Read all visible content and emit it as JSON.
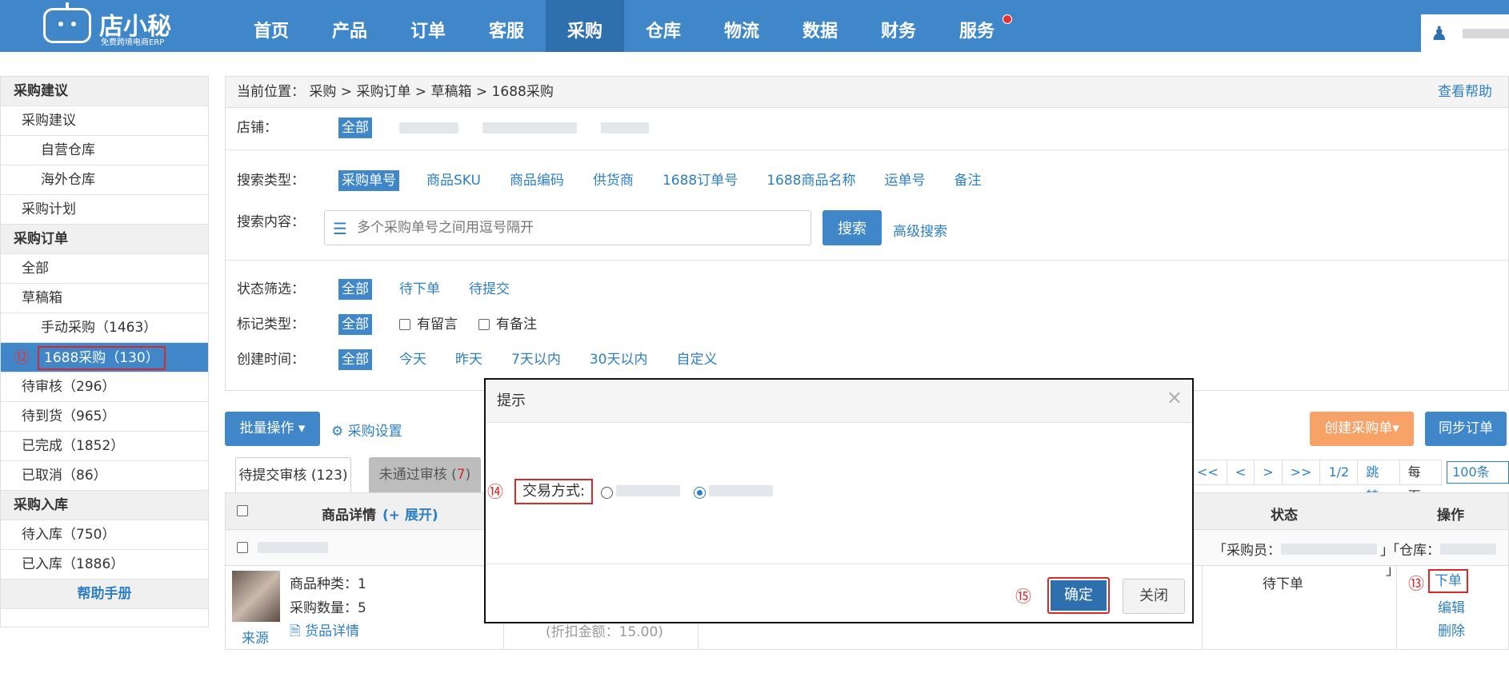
{
  "app": {
    "logo_name": "店小秘",
    "logo_sub": "免费跨境电商ERP",
    "nav": [
      "首页",
      "产品",
      "订单",
      "客服",
      "采购",
      "仓库",
      "物流",
      "数据",
      "财务",
      "服务"
    ],
    "nav_active": "采购"
  },
  "sidebar": {
    "sections": [
      {
        "title": "采购建议",
        "items": [
          {
            "label": "采购建议",
            "level": 1
          },
          {
            "label": "自营仓库",
            "level": 2
          },
          {
            "label": "海外仓库",
            "level": 2
          },
          {
            "label": "采购计划",
            "level": 1
          }
        ]
      },
      {
        "title": "采购订单",
        "items": [
          {
            "label": "全部",
            "level": 1
          },
          {
            "label": "草稿箱",
            "level": 1
          },
          {
            "label": "手动采购（1463）",
            "level": 2
          },
          {
            "label": "1688采购（130）",
            "level": 2,
            "active": true,
            "marker": "⑫"
          },
          {
            "label": "待审核（296）",
            "level": 1
          },
          {
            "label": "待到货（965）",
            "level": 1
          },
          {
            "label": "已完成（1852）",
            "level": 1
          },
          {
            "label": "已取消（86）",
            "level": 1
          }
        ]
      },
      {
        "title": "采购入库",
        "items": [
          {
            "label": "待入库（750）",
            "level": 1
          },
          {
            "label": "已入库（1886）",
            "level": 1
          }
        ]
      }
    ],
    "help": "帮助手册"
  },
  "breadcrumb": {
    "prefix": "当前位置：",
    "path": "采购 > 采购订单 > 草稿箱 > 1688采购",
    "help": "查看帮助"
  },
  "filters": {
    "shop_label": "店铺：",
    "shop_all": "全部",
    "search_type_label": "搜索类型：",
    "search_types": [
      "采购单号",
      "商品SKU",
      "商品编码",
      "供货商",
      "1688订单号",
      "1688商品名称",
      "运单号",
      "备注"
    ],
    "search_content_label": "搜索内容：",
    "search_placeholder": "多个采购单号之间用逗号隔开",
    "search_button": "搜索",
    "advanced": "高级搜索",
    "status_label": "状态筛选：",
    "status_options": [
      "全部",
      "待下单",
      "待提交"
    ],
    "mark_label": "标记类型：",
    "mark_all": "全部",
    "mark_options": [
      "有留言",
      "有备注"
    ],
    "time_label": "创建时间：",
    "time_options": [
      "全部",
      "今天",
      "昨天",
      "7天以内",
      "30天以内",
      "自定义"
    ]
  },
  "toolbar": {
    "batch": "批量操作 ▾",
    "settings": "采购设置",
    "create": "创建采购单▾",
    "sync": "同步订单"
  },
  "tabs": {
    "tab1": "待提交审核 (123)",
    "tab2_label": "未通过审核 (",
    "tab2_count": "7",
    "tab2_end": ")"
  },
  "pager": {
    "first": "<<",
    "prev": "<",
    "next": ">",
    "last": ">>",
    "page": "1/2",
    "jump": "跳转",
    "per_page_label": "每页",
    "per_page": "100条"
  },
  "table": {
    "col_product": "商品详情",
    "expand": "(+ 展开)",
    "col_status": "状态",
    "col_action": "操作",
    "buyer_label": "「采购员：",
    "buyer_end": "」",
    "warehouse_label": "「仓库：",
    "warehouse_end": "」",
    "kinds": "商品种类：1",
    "qty": "采购数量：5",
    "source": "来源",
    "goods_detail": "货品详情",
    "discount": "(折扣金额：15.00)",
    "status": "待下单",
    "action_order": "下单",
    "action_edit": "编辑",
    "action_delete": "删除",
    "marker_13": "⑬"
  },
  "dialog": {
    "title": "提示",
    "close": "×",
    "marker_14": "⑭",
    "trade_label": "交易方式:",
    "ok": "确定",
    "cancel": "关闭",
    "marker_15": "⑮"
  }
}
